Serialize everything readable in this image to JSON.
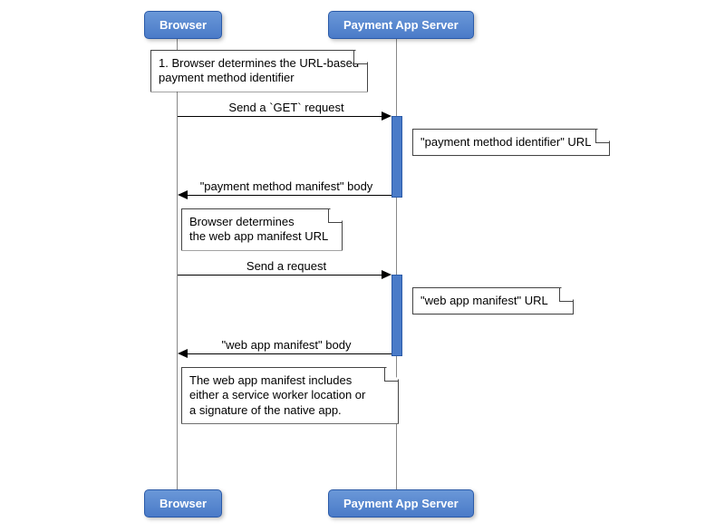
{
  "participants": {
    "browser": "Browser",
    "server": "Payment App Server"
  },
  "notes": {
    "n1_l1": "1. Browser determines the URL-based",
    "n1_l2": "payment method identifier",
    "n2": "\"payment method identifier\" URL",
    "n3_l1": "Browser determines",
    "n3_l2": "the web app manifest URL",
    "n4": "\"web app manifest\" URL",
    "n5_l1": "The web app manifest includes",
    "n5_l2": "either a service worker location or",
    "n5_l3": "a signature of the native app."
  },
  "messages": {
    "m1": "Send a `GET` request",
    "m2": "\"payment method manifest\" body",
    "m3": "Send a request",
    "m4": "\"web app manifest\" body"
  }
}
